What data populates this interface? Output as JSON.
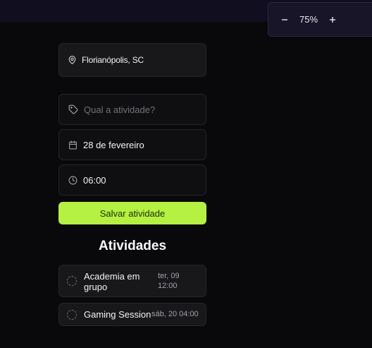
{
  "zoom": {
    "minus_label": "−",
    "value": "75%",
    "plus_label": "+"
  },
  "location": {
    "icon": "map-pin-icon",
    "text": "Florianópolis, SC"
  },
  "form": {
    "activity": {
      "icon": "tag-icon",
      "value": "",
      "placeholder": "Qual a atividade?"
    },
    "date": {
      "icon": "calendar-icon",
      "value": "28 de fevereiro"
    },
    "time": {
      "icon": "clock-icon",
      "value": "06:00"
    },
    "save_label": "Salvar atividade"
  },
  "activities": {
    "title": "Atividades",
    "items": [
      {
        "name": "Academia em grupo",
        "when": "ter, 09 12:00",
        "status_icon": "dashed-circle-icon"
      },
      {
        "name": "Gaming Session",
        "when": "sáb, 20 04:00",
        "status_icon": "dashed-circle-icon"
      }
    ]
  },
  "colors": {
    "background": "#09090b",
    "accent": "#b4f142",
    "card": "#18181b",
    "border": "#27272a"
  }
}
